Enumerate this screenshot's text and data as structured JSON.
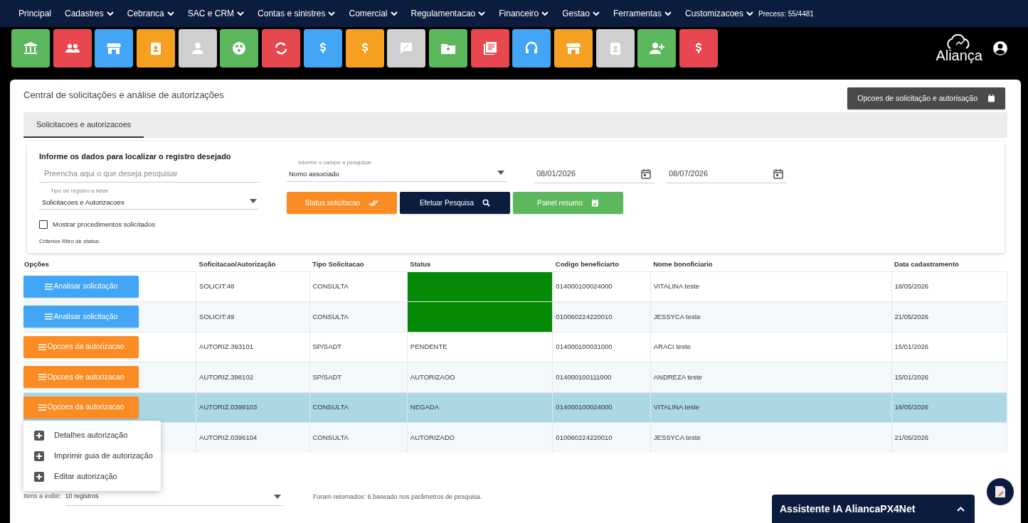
{
  "nav": {
    "items": [
      {
        "label": "Principal",
        "dropdown": false
      },
      {
        "label": "Cadastres",
        "dropdown": true
      },
      {
        "label": "Cebranca",
        "dropdown": true
      },
      {
        "label": "SAC e CRM",
        "dropdown": true
      },
      {
        "label": "Contas e sinistres",
        "dropdown": true
      },
      {
        "label": "Comercial",
        "dropdown": true
      },
      {
        "label": "Regulamentacao",
        "dropdown": true
      },
      {
        "label": "Financeiro",
        "dropdown": true
      },
      {
        "label": "Gestao",
        "dropdown": true
      },
      {
        "label": "Ferramentas",
        "dropdown": true
      },
      {
        "label": "Customizacoes",
        "dropdown": true
      }
    ],
    "process": "Precess: 55/4481"
  },
  "app_tiles": [
    {
      "color": "#5cb85c"
    },
    {
      "color": "#e9474f"
    },
    {
      "color": "#42a5f5"
    },
    {
      "color": "#f5a020"
    },
    {
      "color": "#cfcfcf"
    },
    {
      "color": "#5cb85c"
    },
    {
      "color": "#e9474f"
    },
    {
      "color": "#42a5f5"
    },
    {
      "color": "#f5a020"
    },
    {
      "color": "#cfcfcf"
    },
    {
      "color": "#5cb85c"
    },
    {
      "color": "#e9474f"
    },
    {
      "color": "#42a5f5"
    },
    {
      "color": "#f5a020"
    },
    {
      "color": "#cfcfcf"
    },
    {
      "color": "#5cb85c"
    },
    {
      "color": "#e9474f"
    }
  ],
  "logo": {
    "text": "Aliança"
  },
  "page": {
    "title": "Central de solicitações e análise de autorizações",
    "options_button": "Opcoes de solicitação e autorisação"
  },
  "tabs": [
    {
      "label": "Solicitacoes e autorizacoes",
      "selected": true
    }
  ],
  "filter": {
    "heading": "Informe os dados para localizar o registro desejado",
    "search": {
      "placeholder": "Preencha aqui o que deseja pesquisar"
    },
    "field_select": {
      "label": "Inlorme o campo a pesquisar",
      "value": "Nomo associado"
    },
    "date_from": "08/01/2026",
    "date_to": "08/07/2026",
    "type_select": {
      "label": "Tipo de regisiro a lietar",
      "value": "Solicitacoes e Autorizacoes"
    },
    "buttons": [
      {
        "label": "Status solicitacao",
        "kind": "status"
      },
      {
        "label": "Efetuar Pesquisa",
        "kind": "search"
      },
      {
        "label": "Painel resumo",
        "kind": "summary"
      }
    ],
    "checkbox": {
      "label": "Mostrar procedimentos solicitados",
      "checked": false
    },
    "criteria": "Criterios Ritro de status:"
  },
  "table": {
    "columns": [
      "Opções",
      "Soficitacao/Autorização",
      "Tipo Solicitacao",
      "Status",
      "Codigo beneficiarto",
      "Nome bonoficiario",
      "Data cadastramento"
    ],
    "rows": [
      {
        "action": "Analisar solicitação",
        "kind": "request",
        "id": "SOLICIT:48",
        "type": "CONSULTA",
        "color": "#058a05",
        "code": "014000100024000",
        "name": "VITALINA teste",
        "date": "18/05/2026",
        "selected": false
      },
      {
        "action": "Analisar solicitação",
        "kind": "request",
        "id": "SOLICIT:49",
        "type": "CONSULTA",
        "color": "#058a05",
        "code": "010060224220010",
        "name": "JESSYCA teste",
        "date": "21/05/2026",
        "selected": false
      },
      {
        "action": "Opcoes da autorizacao",
        "kind": "authorization",
        "id": "AUTORIZ.393101",
        "type": "SP/SADT",
        "status": "PENDENTE",
        "code": "014000100031000",
        "name": "ARACI teste",
        "date": "15/01/2026",
        "selected": false
      },
      {
        "action": "Opcoes de autorizacao",
        "kind": "authorization",
        "id": "AUTORIZ.398102",
        "type": "SP/SADT",
        "status": "AUTORIZAOO",
        "code": "014000100111000",
        "name": "ANDREZA teste",
        "date": "15/01/2026",
        "selected": false
      },
      {
        "action": "Opcoes da autorizacao",
        "kind": "authorization",
        "id": "AUTORIZ.0398103",
        "type": "CONSULTA",
        "status": "NEGADA",
        "code": "014000100024000",
        "name": "VITALINA teste",
        "date": "18/05/2026",
        "selected": true
      },
      {
        "id": "AUTORIZ.0396104",
        "type": "CONSULTA",
        "status": "AUTORIZADO",
        "code": "010060224220010",
        "name": "JESSYCA teste",
        "date": "21/05/2026",
        "selected": false
      }
    ]
  },
  "context_menu": [
    "Detalhes autorização",
    "Imprimir guia de autorização",
    "Editar autorização"
  ],
  "footer": {
    "items_label": "Itens a exibir:",
    "items_value": "10 registros",
    "result": "Foram retornadox: 6 baseado nos parâmetros de pesquisa."
  },
  "assistant": {
    "title": "Assistente IA AliancaPX4Net",
    "expanded": false
  }
}
